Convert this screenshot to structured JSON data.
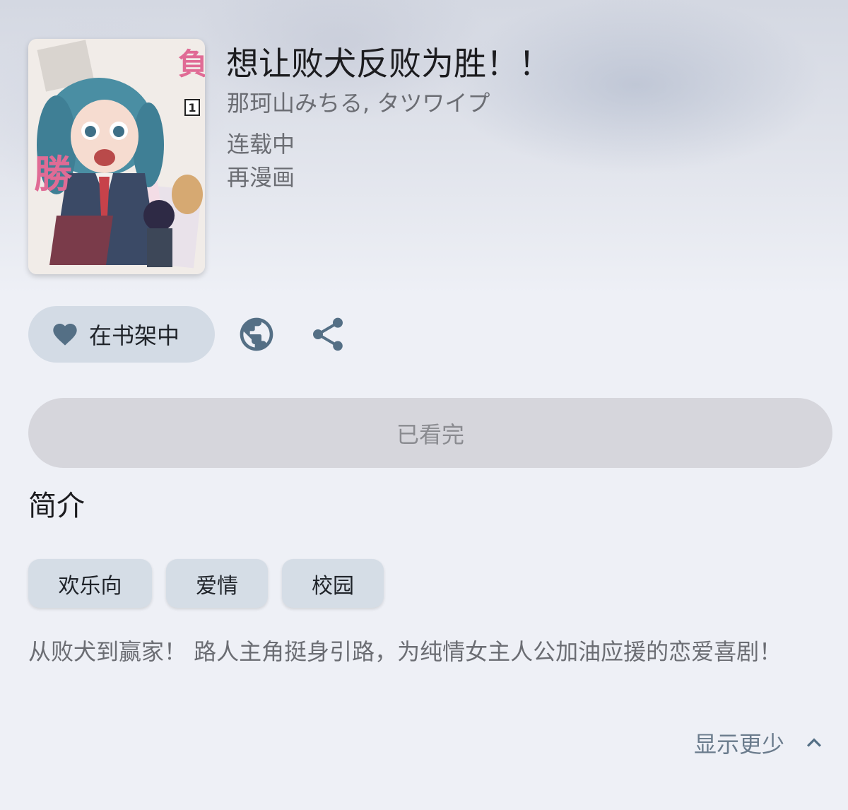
{
  "manga": {
    "title": "想让败犬反败为胜！！",
    "authors": "那珂山みちる, タツワイプ",
    "status": "连载中",
    "source": "再漫画"
  },
  "cover": {
    "title_vertical": "負けヒロインが勝ちたい！",
    "volume": "1"
  },
  "actions": {
    "shelf_label": "在书架中",
    "read_label": "已看完"
  },
  "intro": {
    "heading": "简介",
    "tags": [
      "欢乐向",
      "爱情",
      "校园"
    ],
    "description": "从败犬到赢家！ 路人主角挺身引路，为纯情女主人公加油应援的恋爱喜剧！",
    "toggle_label": "显示更少"
  },
  "colors": {
    "accent_icon": "#546f85",
    "chip_bg": "#d5dde6",
    "button_bg": "#d3dbe5",
    "disabled_bg": "#d6d6dc"
  },
  "icons": [
    "heart-icon",
    "globe-icon",
    "share-icon",
    "chevron-up-icon"
  ]
}
